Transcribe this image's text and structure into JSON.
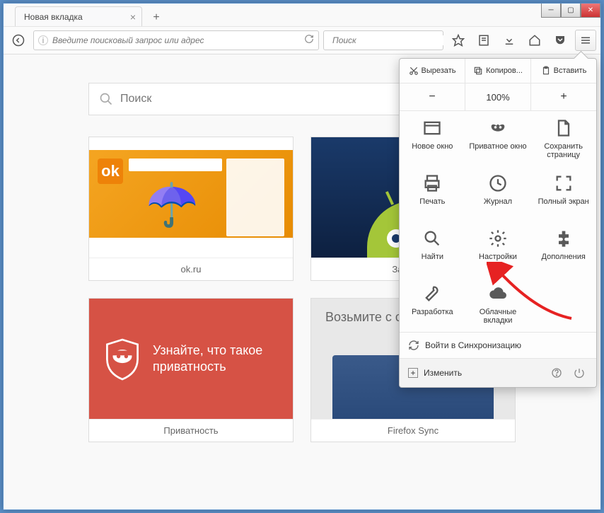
{
  "tab": {
    "title": "Новая вкладка"
  },
  "toolbar": {
    "url_placeholder": "Введите поисковый запрос или адрес",
    "search_placeholder": "Поиск"
  },
  "content": {
    "search_placeholder": "Поиск",
    "tiles": [
      {
        "label": "ok.ru"
      },
      {
        "label": "Загрузить"
      },
      {
        "label": "Приватность",
        "text": "Узнайте, что такое приватность"
      },
      {
        "label": "Firefox Sync",
        "text": "Возьмите с собой"
      }
    ]
  },
  "menu": {
    "edit": {
      "cut": "Вырезать",
      "copy": "Копиров...",
      "paste": "Вставить"
    },
    "zoom": {
      "value": "100%"
    },
    "items": [
      {
        "label": "Новое окно"
      },
      {
        "label": "Приватное окно"
      },
      {
        "label": "Сохранить страницу"
      },
      {
        "label": "Печать"
      },
      {
        "label": "Журнал"
      },
      {
        "label": "Полный экран"
      },
      {
        "label": "Найти"
      },
      {
        "label": "Настройки"
      },
      {
        "label": "Дополнения"
      },
      {
        "label": "Разработка"
      },
      {
        "label": "Облачные вкладки"
      }
    ],
    "sync": "Войти в Синхронизацию",
    "customize": "Изменить"
  }
}
